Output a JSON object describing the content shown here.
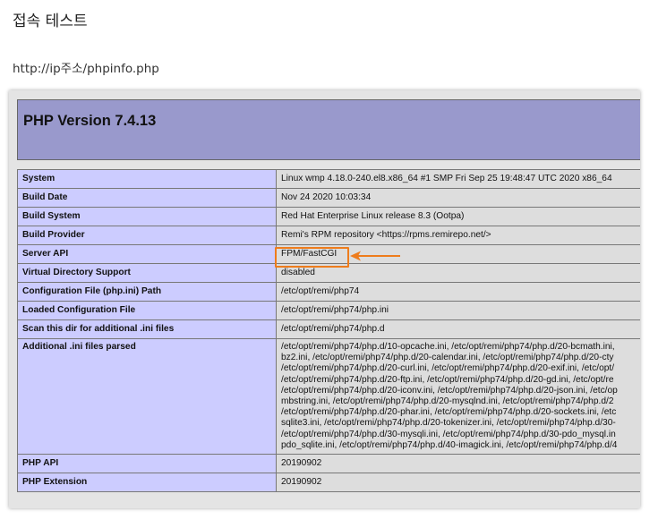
{
  "heading": "접속 테스트",
  "url": "http://ip주소/phpinfo.php",
  "phpinfo": {
    "version_title": "PHP Version 7.4.13",
    "rows": [
      {
        "key": "System",
        "value": [
          "Linux wmp 4.18.0-240.el8.x86_64 #1 SMP Fri Sep 25 19:48:47 UTC 2020 x86_64"
        ]
      },
      {
        "key": "Build Date",
        "value": [
          "Nov 24 2020 10:03:34"
        ]
      },
      {
        "key": "Build System",
        "value": [
          "Red Hat Enterprise Linux release 8.3 (Ootpa)"
        ]
      },
      {
        "key": "Build Provider",
        "value": [
          "Remi's RPM repository <https://rpms.remirepo.net/>"
        ]
      },
      {
        "key": "Server API",
        "value": [
          "FPM/FastCGI"
        ]
      },
      {
        "key": "Virtual Directory Support",
        "value": [
          "disabled"
        ]
      },
      {
        "key": "Configuration File (php.ini) Path",
        "value": [
          "/etc/opt/remi/php74"
        ]
      },
      {
        "key": "Loaded Configuration File",
        "value": [
          "/etc/opt/remi/php74/php.ini"
        ]
      },
      {
        "key": "Scan this dir for additional .ini files",
        "value": [
          "/etc/opt/remi/php74/php.d"
        ]
      },
      {
        "key": "Additional .ini files parsed",
        "value": [
          "/etc/opt/remi/php74/php.d/10-opcache.ini, /etc/opt/remi/php74/php.d/20-bcmath.ini,",
          "bz2.ini, /etc/opt/remi/php74/php.d/20-calendar.ini, /etc/opt/remi/php74/php.d/20-cty",
          "/etc/opt/remi/php74/php.d/20-curl.ini, /etc/opt/remi/php74/php.d/20-exif.ini, /etc/opt/",
          "/etc/opt/remi/php74/php.d/20-ftp.ini, /etc/opt/remi/php74/php.d/20-gd.ini, /etc/opt/re",
          "/etc/opt/remi/php74/php.d/20-iconv.ini, /etc/opt/remi/php74/php.d/20-json.ini, /etc/op",
          "mbstring.ini, /etc/opt/remi/php74/php.d/20-mysqlnd.ini, /etc/opt/remi/php74/php.d/2",
          "/etc/opt/remi/php74/php.d/20-phar.ini, /etc/opt/remi/php74/php.d/20-sockets.ini, /etc",
          "sqlite3.ini, /etc/opt/remi/php74/php.d/20-tokenizer.ini, /etc/opt/remi/php74/php.d/30-",
          "/etc/opt/remi/php74/php.d/30-mysqli.ini, /etc/opt/remi/php74/php.d/30-pdo_mysql.in",
          "pdo_sqlite.ini, /etc/opt/remi/php74/php.d/40-imagick.ini, /etc/opt/remi/php74/php.d/4"
        ]
      },
      {
        "key": "PHP API",
        "value": [
          "20190902"
        ]
      },
      {
        "key": "PHP Extension",
        "value": [
          "20190902"
        ]
      }
    ]
  },
  "annotation": {
    "color": "#ee7c1c",
    "target": "Server API"
  }
}
